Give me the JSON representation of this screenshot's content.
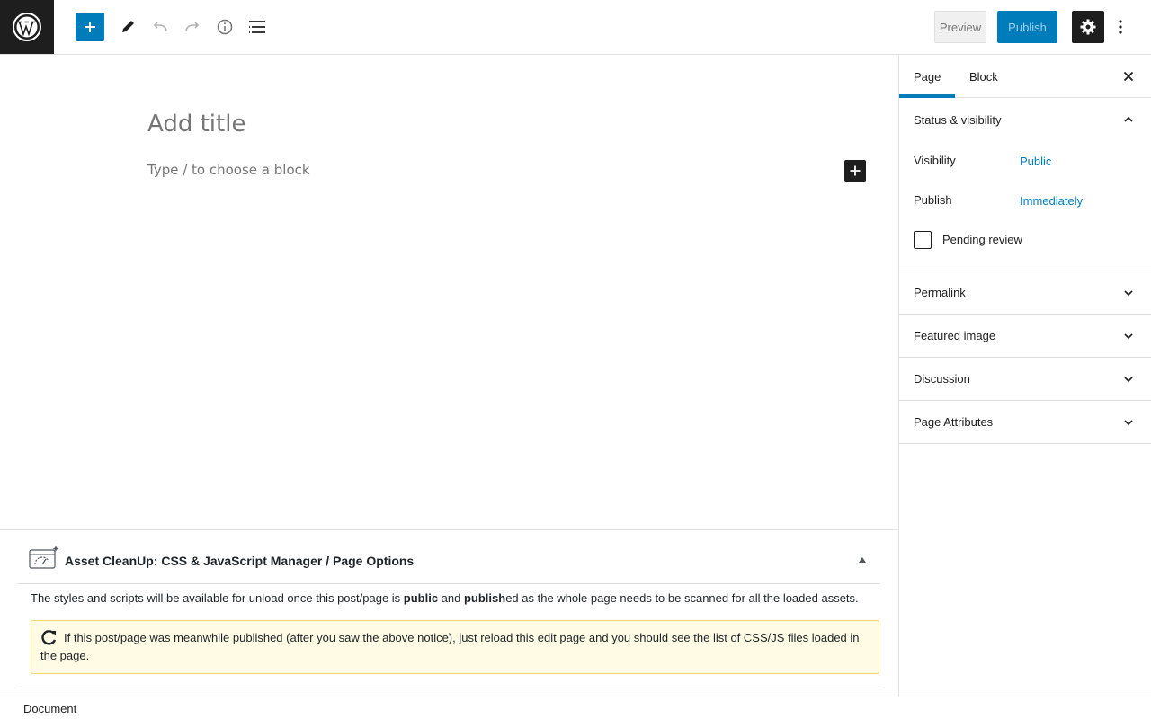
{
  "toolbar": {
    "preview_label": "Preview",
    "publish_label": "Publish",
    "icons": [
      "wordpress-logo-icon",
      "plus-icon",
      "pencil-icon",
      "undo-icon",
      "redo-icon",
      "info-icon",
      "list-view-icon",
      "gear-icon",
      "more-vertical-icon"
    ]
  },
  "editor": {
    "title_placeholder": "Add title",
    "block_placeholder": "Type / to choose a block"
  },
  "metabox": {
    "title": "Asset CleanUp: CSS & JavaScript Manager / Page Options",
    "text_part1": "The styles and scripts will be available for unload once this post/page is ",
    "text_bold1": "public",
    "text_part2": " and ",
    "text_bold2": "publish",
    "text_part3": "ed as the whole page needs to be scanned for all the loaded assets.",
    "notice": "If this post/page was meanwhile published (after you saw the above notice), just reload this edit page and you should see the list of CSS/JS files loaded in the page."
  },
  "statusbar": {
    "label": "Document"
  },
  "sidebar": {
    "tabs": [
      {
        "label": "Page",
        "active": true
      },
      {
        "label": "Block",
        "active": false
      }
    ],
    "status_panel": {
      "title": "Status & visibility",
      "visibility_label": "Visibility",
      "visibility_value": "Public",
      "publish_label": "Publish",
      "publish_value": "Immediately",
      "pending_label": "Pending review",
      "pending_checked": false
    },
    "panels": [
      "Permalink",
      "Featured image",
      "Discussion",
      "Page Attributes"
    ]
  },
  "colors": {
    "accent": "#007cba",
    "dark": "#1e1e1e",
    "notice_bg": "#fffbe5"
  }
}
